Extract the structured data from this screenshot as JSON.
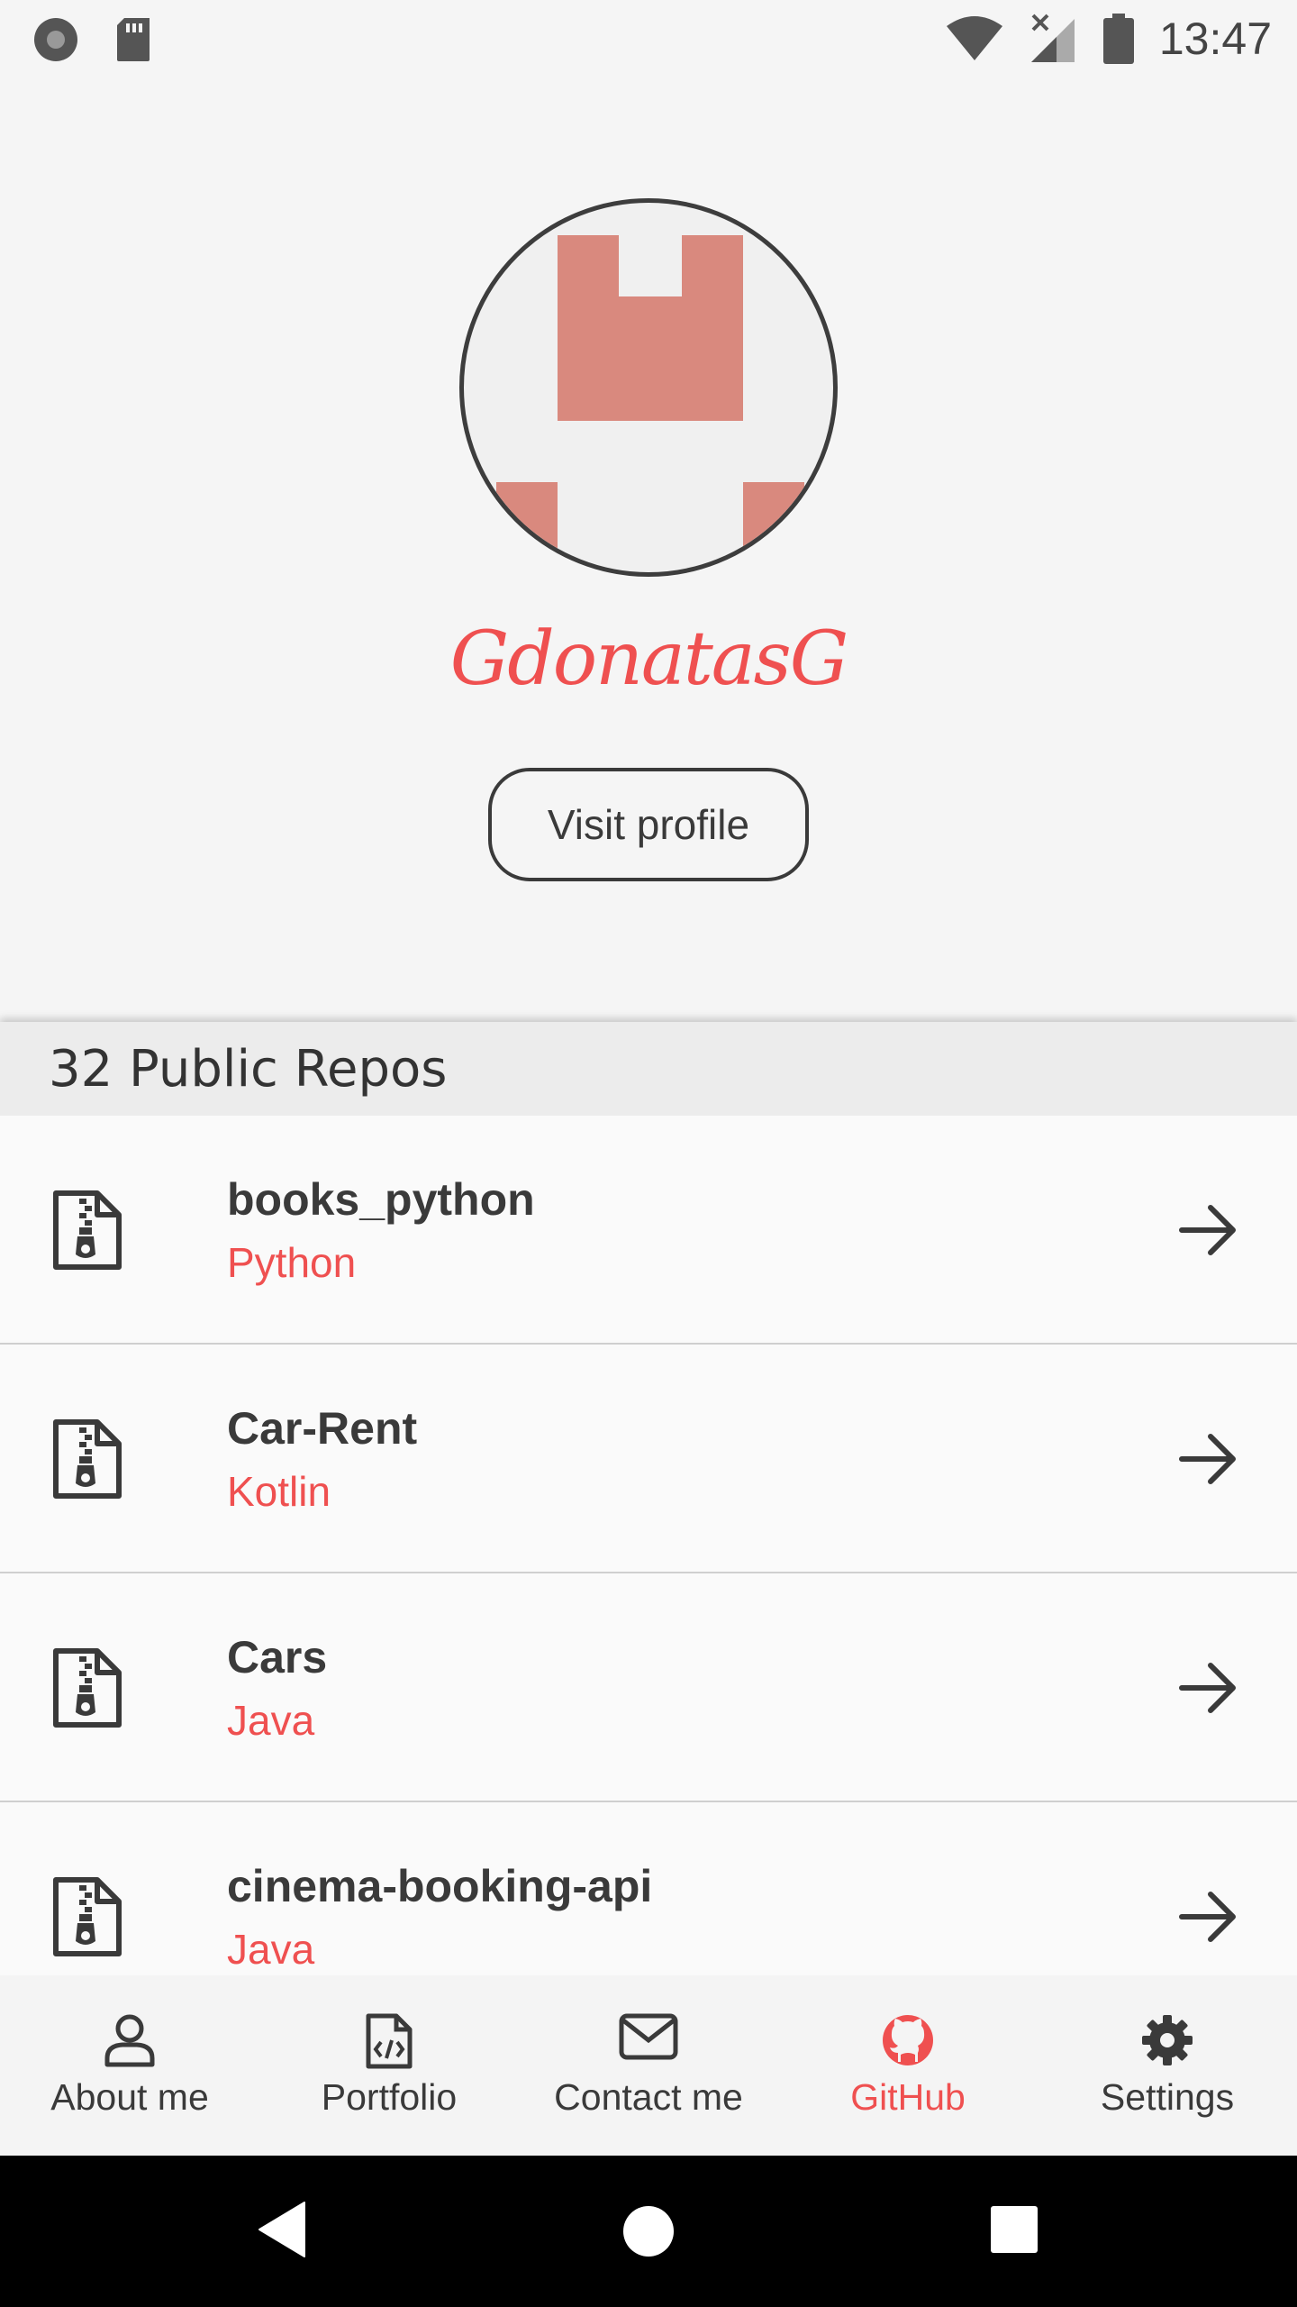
{
  "status_bar": {
    "time": "13:47"
  },
  "profile": {
    "username": "GdonatasG",
    "visit_button_label": "Visit profile",
    "avatar_color": "#d9897e"
  },
  "repos": {
    "header": "32 Public Repos",
    "items": [
      {
        "name": "books_python",
        "language": "Python"
      },
      {
        "name": "Car-Rent",
        "language": "Kotlin"
      },
      {
        "name": "Cars",
        "language": "Java"
      },
      {
        "name": "cinema-booking-api",
        "language": "Java"
      }
    ]
  },
  "bottom_nav": {
    "items": [
      {
        "label": "About me",
        "icon": "person-icon"
      },
      {
        "label": "Portfolio",
        "icon": "code-file-icon"
      },
      {
        "label": "Contact me",
        "icon": "envelope-icon"
      },
      {
        "label": "GitHub",
        "icon": "github-icon",
        "active": true
      },
      {
        "label": "Settings",
        "icon": "gear-icon"
      }
    ]
  },
  "colors": {
    "accent": "#ef5050",
    "text": "#3a3a3a",
    "background": "#f5f5f5"
  }
}
